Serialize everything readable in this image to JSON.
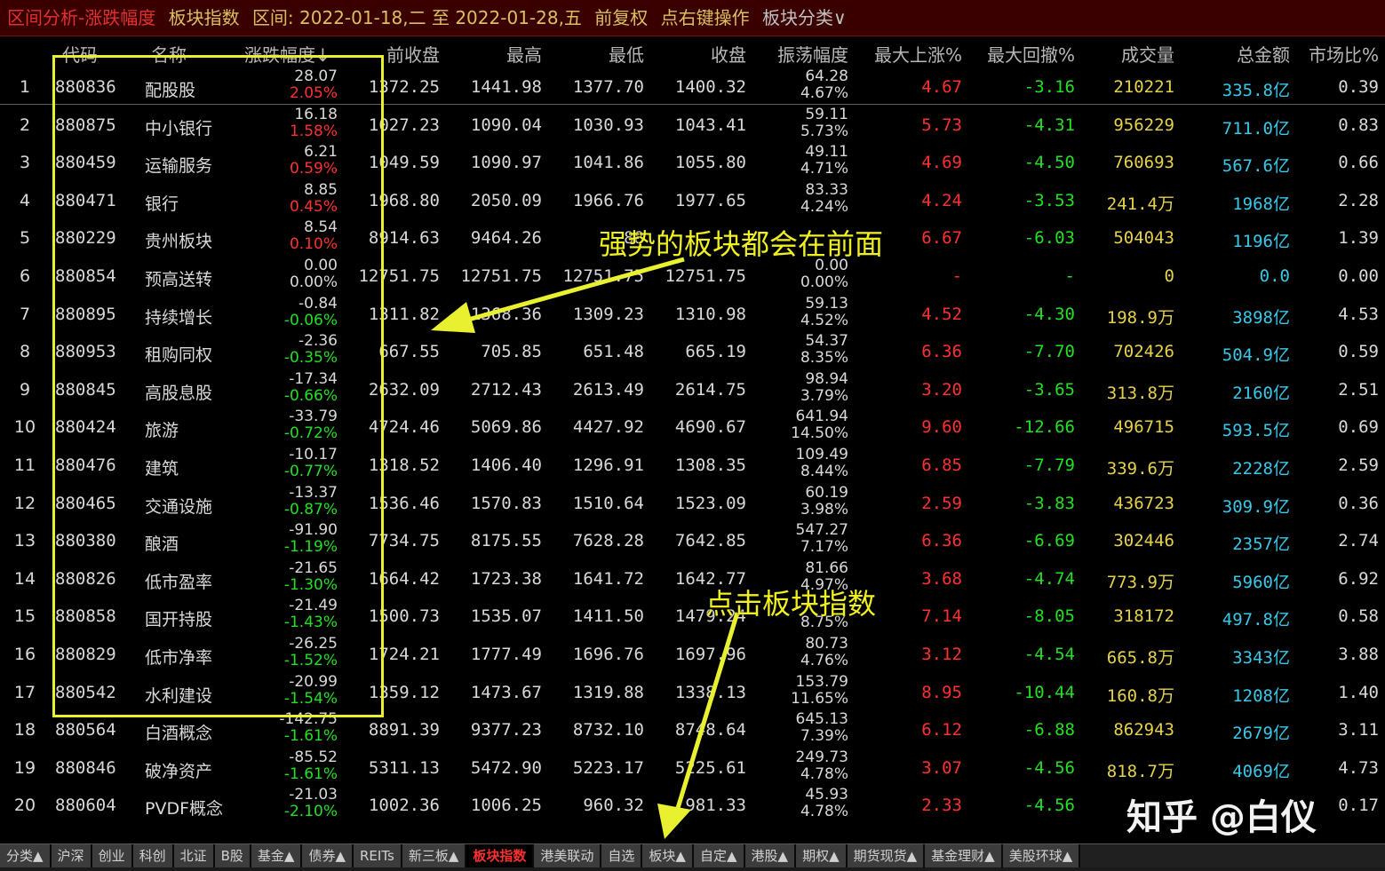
{
  "title": {
    "mode": "区间分析-涨跌幅度",
    "category": "板块指数",
    "range": "区间: 2022-01-18,二 至 2022-01-28,五",
    "adjust": "前复权",
    "hint": "点右键操作",
    "classify": "板块分类∨"
  },
  "columns": [
    "代码",
    "名称",
    "涨跌幅度↓",
    "前收盘",
    "最高",
    "最低",
    "收盘",
    "振荡幅度",
    "最大上涨%",
    "最大回撤%",
    "成交量",
    "总金额",
    "市场比%"
  ],
  "rows": [
    {
      "idx": "1",
      "code": "880836",
      "name": "配股股",
      "chg": "28.07",
      "pct": "2.05%",
      "prev": "1372.25",
      "high": "1441.98",
      "low": "1377.70",
      "close": "1400.32",
      "amp": "64.28",
      "amp_pct": "4.67%",
      "up": "4.67",
      "down": "-3.16",
      "vol": "210221",
      "amount": "335.8亿",
      "share": "0.39",
      "dir": "up"
    },
    {
      "idx": "2",
      "code": "880875",
      "name": "中小银行",
      "chg": "16.18",
      "pct": "1.58%",
      "prev": "1027.23",
      "high": "1090.04",
      "low": "1030.93",
      "close": "1043.41",
      "amp": "59.11",
      "amp_pct": "5.73%",
      "up": "5.73",
      "down": "-4.31",
      "vol": "956229",
      "amount": "711.0亿",
      "share": "0.83",
      "dir": "up"
    },
    {
      "idx": "3",
      "code": "880459",
      "name": "运输服务",
      "chg": "6.21",
      "pct": "0.59%",
      "prev": "1049.59",
      "high": "1090.97",
      "low": "1041.86",
      "close": "1055.80",
      "amp": "49.11",
      "amp_pct": "4.71%",
      "up": "4.69",
      "down": "-4.50",
      "vol": "760693",
      "amount": "567.6亿",
      "share": "0.66",
      "dir": "up"
    },
    {
      "idx": "4",
      "code": "880471",
      "name": "银行",
      "chg": "8.85",
      "pct": "0.45%",
      "prev": "1968.80",
      "high": "2050.09",
      "low": "1966.76",
      "close": "1977.65",
      "amp": "83.33",
      "amp_pct": "4.24%",
      "up": "4.24",
      "down": "-3.53",
      "vol": "241.4万",
      "amount": "1968亿",
      "share": "2.28",
      "dir": "up"
    },
    {
      "idx": "5",
      "code": "880229",
      "name": "贵州板块",
      "chg": "8.54",
      "pct": "0.10%",
      "prev": "8914.63",
      "high": "9464.26",
      "low": "88",
      "close": "",
      "amp": "",
      "amp_pct": "",
      "up": "6.67",
      "down": "-6.03",
      "vol": "504043",
      "amount": "1196亿",
      "share": "1.39",
      "dir": "up"
    },
    {
      "idx": "6",
      "code": "880854",
      "name": "预高送转",
      "chg": "0.00",
      "pct": "0.00%",
      "prev": "12751.75",
      "high": "12751.75",
      "low": "12751.75",
      "close": "12751.75",
      "amp": "0.00",
      "amp_pct": "0.00%",
      "up": "-",
      "down": "-",
      "vol": "0",
      "amount": "0.0",
      "share": "0.00",
      "dir": "flat"
    },
    {
      "idx": "7",
      "code": "880895",
      "name": "持续增长",
      "chg": "-0.84",
      "pct": "-0.06%",
      "prev": "1311.82",
      "high": "1368.36",
      "low": "1309.23",
      "close": "1310.98",
      "amp": "59.13",
      "amp_pct": "4.52%",
      "up": "4.52",
      "down": "-4.30",
      "vol": "198.9万",
      "amount": "3898亿",
      "share": "4.53",
      "dir": "down"
    },
    {
      "idx": "8",
      "code": "880953",
      "name": "租购同权",
      "chg": "-2.36",
      "pct": "-0.35%",
      "prev": "667.55",
      "high": "705.85",
      "low": "651.48",
      "close": "665.19",
      "amp": "54.37",
      "amp_pct": "8.35%",
      "up": "6.36",
      "down": "-7.70",
      "vol": "702426",
      "amount": "504.9亿",
      "share": "0.59",
      "dir": "down"
    },
    {
      "idx": "9",
      "code": "880845",
      "name": "高股息股",
      "chg": "-17.34",
      "pct": "-0.66%",
      "prev": "2632.09",
      "high": "2712.43",
      "low": "2613.49",
      "close": "2614.75",
      "amp": "98.94",
      "amp_pct": "3.79%",
      "up": "3.20",
      "down": "-3.65",
      "vol": "313.8万",
      "amount": "2160亿",
      "share": "2.51",
      "dir": "down"
    },
    {
      "idx": "10",
      "code": "880424",
      "name": "旅游",
      "chg": "-33.79",
      "pct": "-0.72%",
      "prev": "4724.46",
      "high": "5069.86",
      "low": "4427.92",
      "close": "4690.67",
      "amp": "641.94",
      "amp_pct": "14.50%",
      "up": "9.60",
      "down": "-12.66",
      "vol": "496715",
      "amount": "593.5亿",
      "share": "0.69",
      "dir": "down"
    },
    {
      "idx": "11",
      "code": "880476",
      "name": "建筑",
      "chg": "-10.17",
      "pct": "-0.77%",
      "prev": "1318.52",
      "high": "1406.40",
      "low": "1296.91",
      "close": "1308.35",
      "amp": "109.49",
      "amp_pct": "8.44%",
      "up": "6.85",
      "down": "-7.79",
      "vol": "339.6万",
      "amount": "2228亿",
      "share": "2.59",
      "dir": "down"
    },
    {
      "idx": "12",
      "code": "880465",
      "name": "交通设施",
      "chg": "-13.37",
      "pct": "-0.87%",
      "prev": "1536.46",
      "high": "1570.83",
      "low": "1510.64",
      "close": "1523.09",
      "amp": "60.19",
      "amp_pct": "3.98%",
      "up": "2.59",
      "down": "-3.83",
      "vol": "436723",
      "amount": "309.9亿",
      "share": "0.36",
      "dir": "down"
    },
    {
      "idx": "13",
      "code": "880380",
      "name": "酿酒",
      "chg": "-91.90",
      "pct": "-1.19%",
      "prev": "7734.75",
      "high": "8175.55",
      "low": "7628.28",
      "close": "7642.85",
      "amp": "547.27",
      "amp_pct": "7.17%",
      "up": "6.36",
      "down": "-6.69",
      "vol": "302446",
      "amount": "2357亿",
      "share": "2.74",
      "dir": "down"
    },
    {
      "idx": "14",
      "code": "880826",
      "name": "低市盈率",
      "chg": "-21.65",
      "pct": "-1.30%",
      "prev": "1664.42",
      "high": "1723.38",
      "low": "1641.72",
      "close": "1642.77",
      "amp": "81.66",
      "amp_pct": "4.97%",
      "up": "3.68",
      "down": "-4.74",
      "vol": "773.9万",
      "amount": "5960亿",
      "share": "6.92",
      "dir": "down"
    },
    {
      "idx": "15",
      "code": "880858",
      "name": "国开持股",
      "chg": "-21.49",
      "pct": "-1.43%",
      "prev": "1500.73",
      "high": "1535.07",
      "low": "1411.50",
      "close": "1479.24",
      "amp": "",
      "amp_pct": "8.75%",
      "up": "7.14",
      "down": "-8.05",
      "vol": "318172",
      "amount": "497.8亿",
      "share": "0.58",
      "dir": "down"
    },
    {
      "idx": "16",
      "code": "880829",
      "name": "低市净率",
      "chg": "-26.25",
      "pct": "-1.52%",
      "prev": "1724.21",
      "high": "1777.49",
      "low": "1696.76",
      "close": "1697.96",
      "amp": "80.73",
      "amp_pct": "4.76%",
      "up": "3.12",
      "down": "-4.54",
      "vol": "665.8万",
      "amount": "3343亿",
      "share": "3.88",
      "dir": "down"
    },
    {
      "idx": "17",
      "code": "880542",
      "name": "水利建设",
      "chg": "-20.99",
      "pct": "-1.54%",
      "prev": "1359.12",
      "high": "1473.67",
      "low": "1319.88",
      "close": "1338.13",
      "amp": "153.79",
      "amp_pct": "11.65%",
      "up": "8.95",
      "down": "-10.44",
      "vol": "160.8万",
      "amount": "1208亿",
      "share": "1.40",
      "dir": "down"
    },
    {
      "idx": "18",
      "code": "880564",
      "name": "白酒概念",
      "chg": "-142.75",
      "pct": "-1.61%",
      "prev": "8891.39",
      "high": "9377.23",
      "low": "8732.10",
      "close": "8748.64",
      "amp": "645.13",
      "amp_pct": "7.39%",
      "up": "6.12",
      "down": "-6.88",
      "vol": "862943",
      "amount": "2679亿",
      "share": "3.11",
      "dir": "down"
    },
    {
      "idx": "19",
      "code": "880846",
      "name": "破净资产",
      "chg": "-85.52",
      "pct": "-1.61%",
      "prev": "5311.13",
      "high": "5472.90",
      "low": "5223.17",
      "close": "5225.61",
      "amp": "249.73",
      "amp_pct": "4.78%",
      "up": "3.07",
      "down": "-4.56",
      "vol": "818.7万",
      "amount": "4069亿",
      "share": "4.73",
      "dir": "down"
    },
    {
      "idx": "20",
      "code": "880604",
      "name": "PVDF概念",
      "chg": "-21.03",
      "pct": "-2.10%",
      "prev": "1002.36",
      "high": "1006.25",
      "low": "960.32",
      "close": "981.33",
      "amp": "45.93",
      "amp_pct": "4.78%",
      "up": "2.33",
      "down": "-4.56",
      "vol": "",
      "amount": "",
      "share": "0.17",
      "dir": "down"
    }
  ],
  "annotations": {
    "strong_sectors": "强势的板块都会在前面",
    "click_tab": "点击板块指数"
  },
  "watermark": "知乎 @白仪",
  "tabs": [
    "分类▲",
    "沪深",
    "创业",
    "科创",
    "北证",
    "B股",
    "基金▲",
    "债券▲",
    "REITs",
    "新三板▲",
    "板块指数",
    "港美联动",
    "自选",
    "板块▲",
    "自定▲",
    "港股▲",
    "期权▲",
    "期货现货▲",
    "基金理财▲",
    "美股环球▲"
  ],
  "active_tab": "板块指数",
  "colors": {
    "up": "#ff3030",
    "down": "#22e022",
    "annotation": "#f0f020"
  }
}
